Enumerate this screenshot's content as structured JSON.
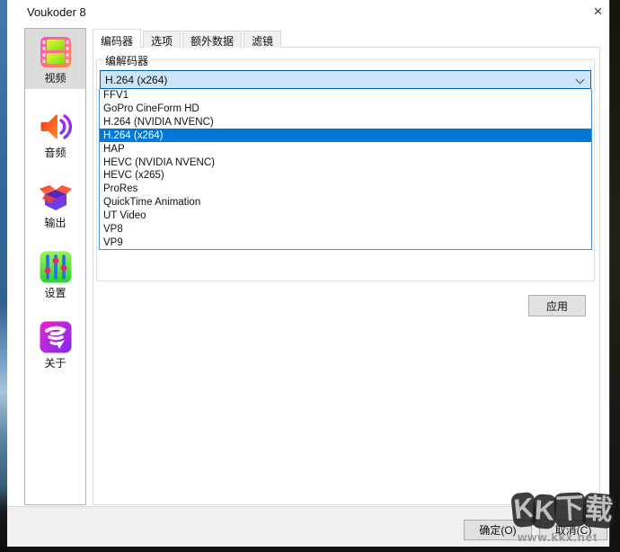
{
  "window": {
    "title": "Voukoder 8",
    "close_glyph": "×"
  },
  "sidebar": {
    "items": [
      {
        "label": "视频",
        "icon": "film-icon",
        "selected": true
      },
      {
        "label": "音频",
        "icon": "speaker-icon",
        "selected": false
      },
      {
        "label": "输出",
        "icon": "box-icon",
        "selected": false
      },
      {
        "label": "设置",
        "icon": "sliders-icon",
        "selected": false
      },
      {
        "label": "关于",
        "icon": "tornado-icon",
        "selected": false
      }
    ]
  },
  "tabs": [
    {
      "label": "编码器",
      "active": true
    },
    {
      "label": "选项",
      "active": false
    },
    {
      "label": "额外数据",
      "active": false
    },
    {
      "label": "滤镜",
      "active": false
    }
  ],
  "encoder_group": {
    "label": "编解码器",
    "combobox": {
      "value": "H.264 (x264)"
    },
    "dropdown": {
      "selected_index": 3,
      "options": [
        "FFV1",
        "GoPro CineForm HD",
        "H.264 (NVIDIA NVENC)",
        "H.264 (x264)",
        "HAP",
        "HEVC (NVIDIA NVENC)",
        "HEVC (x265)",
        "ProRes",
        "QuickTime Animation",
        "UT Video",
        "VP8",
        "VP9"
      ]
    }
  },
  "buttons": {
    "apply": "应用",
    "ok": "确定(O)",
    "cancel": "取消(C)"
  },
  "watermark": {
    "ch1": "K",
    "ch2": "K",
    "ch3": "下",
    "ch4": "载",
    "url": "www.kkx.net"
  },
  "colors": {
    "accent": "#0078d7",
    "combo_bg": "#cce4f7",
    "selection": "#0078d7"
  }
}
